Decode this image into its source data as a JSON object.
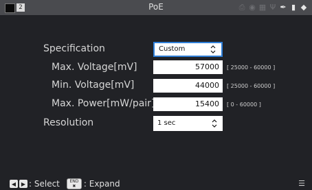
{
  "status_bar": {
    "title": "PoE",
    "indicator_number": "2",
    "icons": [
      "printer-icon",
      "wifi-icon",
      "network-icon",
      "usb-icon",
      "pen-icon",
      "battery-icon",
      "plug-icon"
    ]
  },
  "settings": {
    "specification": {
      "label": "Specification",
      "value": "Custom"
    },
    "max_voltage": {
      "label": "Max. Voltage[mV]",
      "value": "57000",
      "range": "[ 25000 - 60000 ]"
    },
    "min_voltage": {
      "label": "Min. Voltage[mV]",
      "value": "44000",
      "range": "[ 25000 - 60000 ]"
    },
    "max_power": {
      "label": "Max. Power[mW/pair]",
      "value": "15400",
      "range": "[ 0 - 60000 ]"
    },
    "resolution": {
      "label": "Resolution",
      "value": "1 sec"
    }
  },
  "bottom_bar": {
    "select_label": ": Select",
    "end_key": "END",
    "expand_label": ": Expand"
  },
  "colors": {
    "accent": "#2f7fd8",
    "statusbar": "#4a4b4f",
    "background": "#212226"
  }
}
